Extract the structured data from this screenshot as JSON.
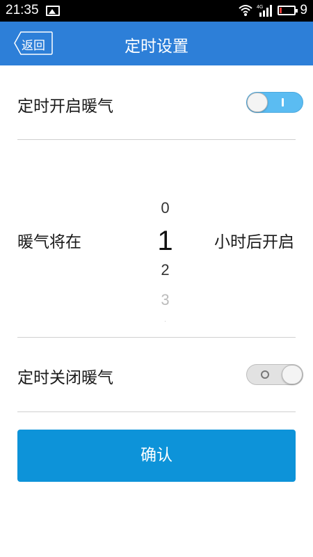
{
  "status_bar": {
    "time": "21:35",
    "network": "4G",
    "battery_level": "9",
    "icons": [
      "image-icon",
      "wifi-icon",
      "signal-icon",
      "battery-icon"
    ]
  },
  "header": {
    "back_label": "返回",
    "title": "定时设置",
    "background_color": "#2d7fd8"
  },
  "timer_on": {
    "label": "定时开启暖气",
    "enabled": true
  },
  "countdown": {
    "prefix": "暖气将在",
    "suffix": "小时后开启",
    "options": [
      "0",
      "1",
      "2",
      "3"
    ],
    "selected": "1"
  },
  "timer_off": {
    "label": "定时关闭暖气",
    "enabled": false
  },
  "confirm": {
    "label": "确认",
    "color": "#0d93d9"
  }
}
